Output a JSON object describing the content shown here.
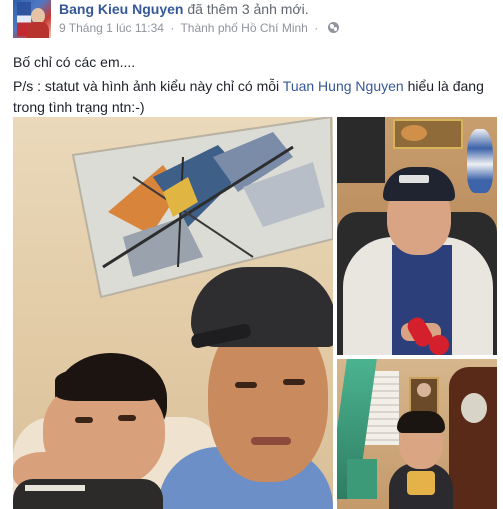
{
  "post": {
    "author": "Bang Kieu Nguyen",
    "action_prefix": "đã thêm",
    "action_link": "3 ảnh mới",
    "action_suffix": ".",
    "timestamp": "9 Tháng 1 lúc 11:34",
    "separator": "·",
    "location": "Thành phố Hồ Chí Minh",
    "privacy_icon": "globe-icon",
    "text_line1": "Bố chỉ có các em....",
    "text_line2_prefix": "P/s : statut và hình ảnh kiểu này chỉ có mỗi ",
    "mention": "Tuan Hung Nguyen",
    "text_line2_suffix": " hiểu là đang trong tình trạng ntn:-)"
  },
  "colors": {
    "link": "#365899",
    "meta": "#90949c",
    "text": "#1d2129"
  },
  "photos": [
    {
      "name": "selfie-father-son"
    },
    {
      "name": "boy-in-cap-with-toy"
    },
    {
      "name": "boy-by-door"
    }
  ]
}
